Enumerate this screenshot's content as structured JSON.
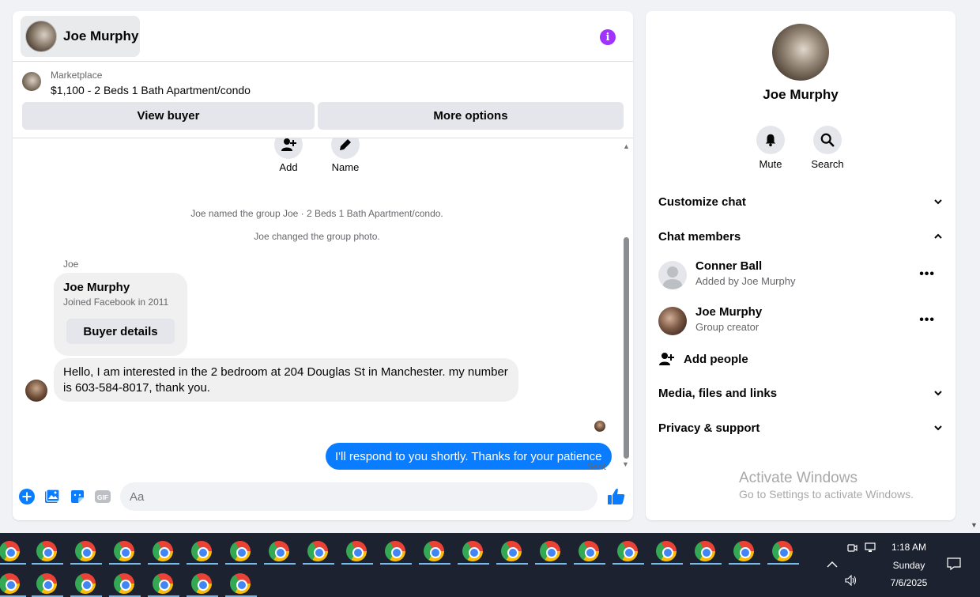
{
  "chat": {
    "header_name": "Joe Murphy",
    "listing_source": "Marketplace",
    "listing_title": "$1,100 - 2 Beds 1 Bath Apartment/condo",
    "view_buyer_label": "View buyer",
    "more_options_label": "More options",
    "actions": [
      {
        "label": "Add",
        "icon": "add-person-icon"
      },
      {
        "label": "Name",
        "icon": "pencil-icon"
      }
    ],
    "system_messages": [
      "Joe named the group Joe · 2 Beds 1 Bath Apartment/condo.",
      "Joe changed the group photo."
    ],
    "sender_label": "Joe",
    "card": {
      "name": "Joe Murphy",
      "subtitle": "Joined Facebook in 2011",
      "button_label": "Buyer details"
    },
    "incoming_message": "Hello, I am interested in the 2 bedroom at 204 Douglas St in Manchester. my number is 603-584-8017, thank you.",
    "outgoing_message": "I'll respond to you shortly. Thanks for your patience",
    "sent_label": "Sent",
    "input_placeholder": "Aa"
  },
  "info": {
    "name": "Joe Murphy",
    "actions": [
      {
        "label": "Mute",
        "icon": "bell-icon"
      },
      {
        "label": "Search",
        "icon": "search-icon"
      }
    ],
    "sections": {
      "customize": "Customize chat",
      "members": "Chat members",
      "media": "Media, files and links",
      "privacy": "Privacy & support"
    },
    "members": [
      {
        "name": "Conner Ball",
        "sub": "Added by Joe Murphy"
      },
      {
        "name": "Joe Murphy",
        "sub": "Group creator"
      }
    ],
    "add_people": "Add people",
    "watermark_title": "Activate Windows",
    "watermark_sub": "Go to Settings to activate Windows."
  },
  "taskbar": {
    "time": "1:18 AM",
    "day": "Sunday",
    "date": "7/6/2025"
  },
  "colors": {
    "accent": "#0a7cff",
    "info_icon": "#a033ff",
    "bubble_incoming": "#f0f0f0",
    "taskbar": "#1c2230"
  }
}
